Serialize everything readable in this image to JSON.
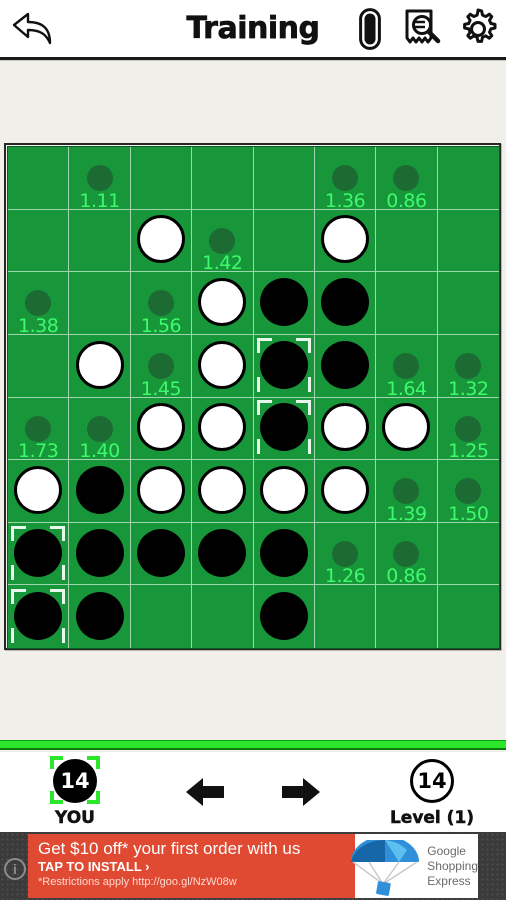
{
  "header": {
    "title": "Training",
    "back_icon": "back-arrow-icon",
    "icons": [
      {
        "name": "disc-theme-icon",
        "label": "Disc theme"
      },
      {
        "name": "analysis-receipt-icon",
        "label": "Analysis"
      },
      {
        "name": "gear-icon",
        "label": "Settings"
      }
    ]
  },
  "board": {
    "rows": 8,
    "cols": 8,
    "colors": {
      "felt": "#17963a",
      "grid_line": "#9fd6ae",
      "hint_dot": "#1c6b32",
      "hint_text": "#3dfa6c",
      "black_disc": "#000000",
      "white_disc": "#ffffff",
      "selection": "#e8f7ec"
    },
    "cells": [
      [
        {
          "piece": null,
          "hint": null,
          "selected": false
        },
        {
          "piece": null,
          "hint": "1.11",
          "selected": false
        },
        {
          "piece": null,
          "hint": null,
          "selected": false
        },
        {
          "piece": null,
          "hint": null,
          "selected": false
        },
        {
          "piece": null,
          "hint": null,
          "selected": false
        },
        {
          "piece": null,
          "hint": "1.36",
          "selected": false
        },
        {
          "piece": null,
          "hint": "0.86",
          "selected": false
        },
        {
          "piece": null,
          "hint": null,
          "selected": false
        }
      ],
      [
        {
          "piece": null,
          "hint": null,
          "selected": false
        },
        {
          "piece": null,
          "hint": null,
          "selected": false
        },
        {
          "piece": "white",
          "hint": null,
          "selected": false
        },
        {
          "piece": null,
          "hint": "1.42",
          "selected": false
        },
        {
          "piece": null,
          "hint": null,
          "selected": false
        },
        {
          "piece": "white",
          "hint": null,
          "selected": false
        },
        {
          "piece": null,
          "hint": null,
          "selected": false
        },
        {
          "piece": null,
          "hint": null,
          "selected": false
        }
      ],
      [
        {
          "piece": null,
          "hint": "1.38",
          "selected": false
        },
        {
          "piece": null,
          "hint": null,
          "selected": false
        },
        {
          "piece": null,
          "hint": "1.56",
          "selected": false
        },
        {
          "piece": "white",
          "hint": null,
          "selected": false
        },
        {
          "piece": "black",
          "hint": null,
          "selected": false
        },
        {
          "piece": "black",
          "hint": null,
          "selected": false
        },
        {
          "piece": null,
          "hint": null,
          "selected": false
        },
        {
          "piece": null,
          "hint": null,
          "selected": false
        }
      ],
      [
        {
          "piece": null,
          "hint": null,
          "selected": false
        },
        {
          "piece": "white",
          "hint": null,
          "selected": false
        },
        {
          "piece": null,
          "hint": "1.45",
          "selected": false
        },
        {
          "piece": "white",
          "hint": null,
          "selected": false
        },
        {
          "piece": "black",
          "hint": null,
          "selected": true
        },
        {
          "piece": "black",
          "hint": null,
          "selected": false
        },
        {
          "piece": null,
          "hint": "1.64",
          "selected": false
        },
        {
          "piece": null,
          "hint": "1.32",
          "selected": false
        }
      ],
      [
        {
          "piece": null,
          "hint": "1.73",
          "selected": false
        },
        {
          "piece": null,
          "hint": "1.40",
          "selected": false
        },
        {
          "piece": "white",
          "hint": null,
          "selected": false
        },
        {
          "piece": "white",
          "hint": null,
          "selected": false
        },
        {
          "piece": "black",
          "hint": null,
          "selected": true
        },
        {
          "piece": "white",
          "hint": null,
          "selected": false
        },
        {
          "piece": "white",
          "hint": null,
          "selected": false
        },
        {
          "piece": null,
          "hint": "1.25",
          "selected": false
        }
      ],
      [
        {
          "piece": "white",
          "hint": null,
          "selected": false
        },
        {
          "piece": "black",
          "hint": null,
          "selected": false
        },
        {
          "piece": "white",
          "hint": null,
          "selected": false
        },
        {
          "piece": "white",
          "hint": null,
          "selected": false
        },
        {
          "piece": "white",
          "hint": null,
          "selected": false
        },
        {
          "piece": "white",
          "hint": null,
          "selected": false
        },
        {
          "piece": null,
          "hint": "1.39",
          "selected": false
        },
        {
          "piece": null,
          "hint": "1.50",
          "selected": false
        }
      ],
      [
        {
          "piece": "black",
          "hint": null,
          "selected": true
        },
        {
          "piece": "black",
          "hint": null,
          "selected": false
        },
        {
          "piece": "black",
          "hint": null,
          "selected": false
        },
        {
          "piece": "black",
          "hint": null,
          "selected": false
        },
        {
          "piece": "black",
          "hint": null,
          "selected": false
        },
        {
          "piece": null,
          "hint": "1.26",
          "selected": false
        },
        {
          "piece": null,
          "hint": "0.86",
          "selected": false
        },
        {
          "piece": null,
          "hint": null,
          "selected": false
        }
      ],
      [
        {
          "piece": "black",
          "hint": null,
          "selected": true
        },
        {
          "piece": "black",
          "hint": null,
          "selected": false
        },
        {
          "piece": null,
          "hint": null,
          "selected": false
        },
        {
          "piece": null,
          "hint": null,
          "selected": false
        },
        {
          "piece": "black",
          "hint": null,
          "selected": false
        },
        {
          "piece": null,
          "hint": null,
          "selected": false
        },
        {
          "piece": null,
          "hint": null,
          "selected": false
        },
        {
          "piece": null,
          "hint": null,
          "selected": false
        }
      ]
    ]
  },
  "footer": {
    "you": {
      "score": "14",
      "label": "YOU",
      "disc": "black",
      "active": true
    },
    "opponent": {
      "score": "14",
      "label": "Level (1)",
      "disc": "white",
      "active": false
    },
    "prev_icon": "left-arrow-icon",
    "next_icon": "right-arrow-icon",
    "accent": "#2ce62c"
  },
  "ad": {
    "headline": "Get $10 off* your first order with us",
    "cta": "TAP TO INSTALL ›",
    "fine_print": "*Restrictions apply http://goo.gl/NzW08w",
    "brand": "Google\nShopping\nExpress",
    "brand_lines": [
      "Google",
      "Shopping",
      "Express"
    ],
    "info_glyph": "i",
    "bg": "#e04a32"
  }
}
